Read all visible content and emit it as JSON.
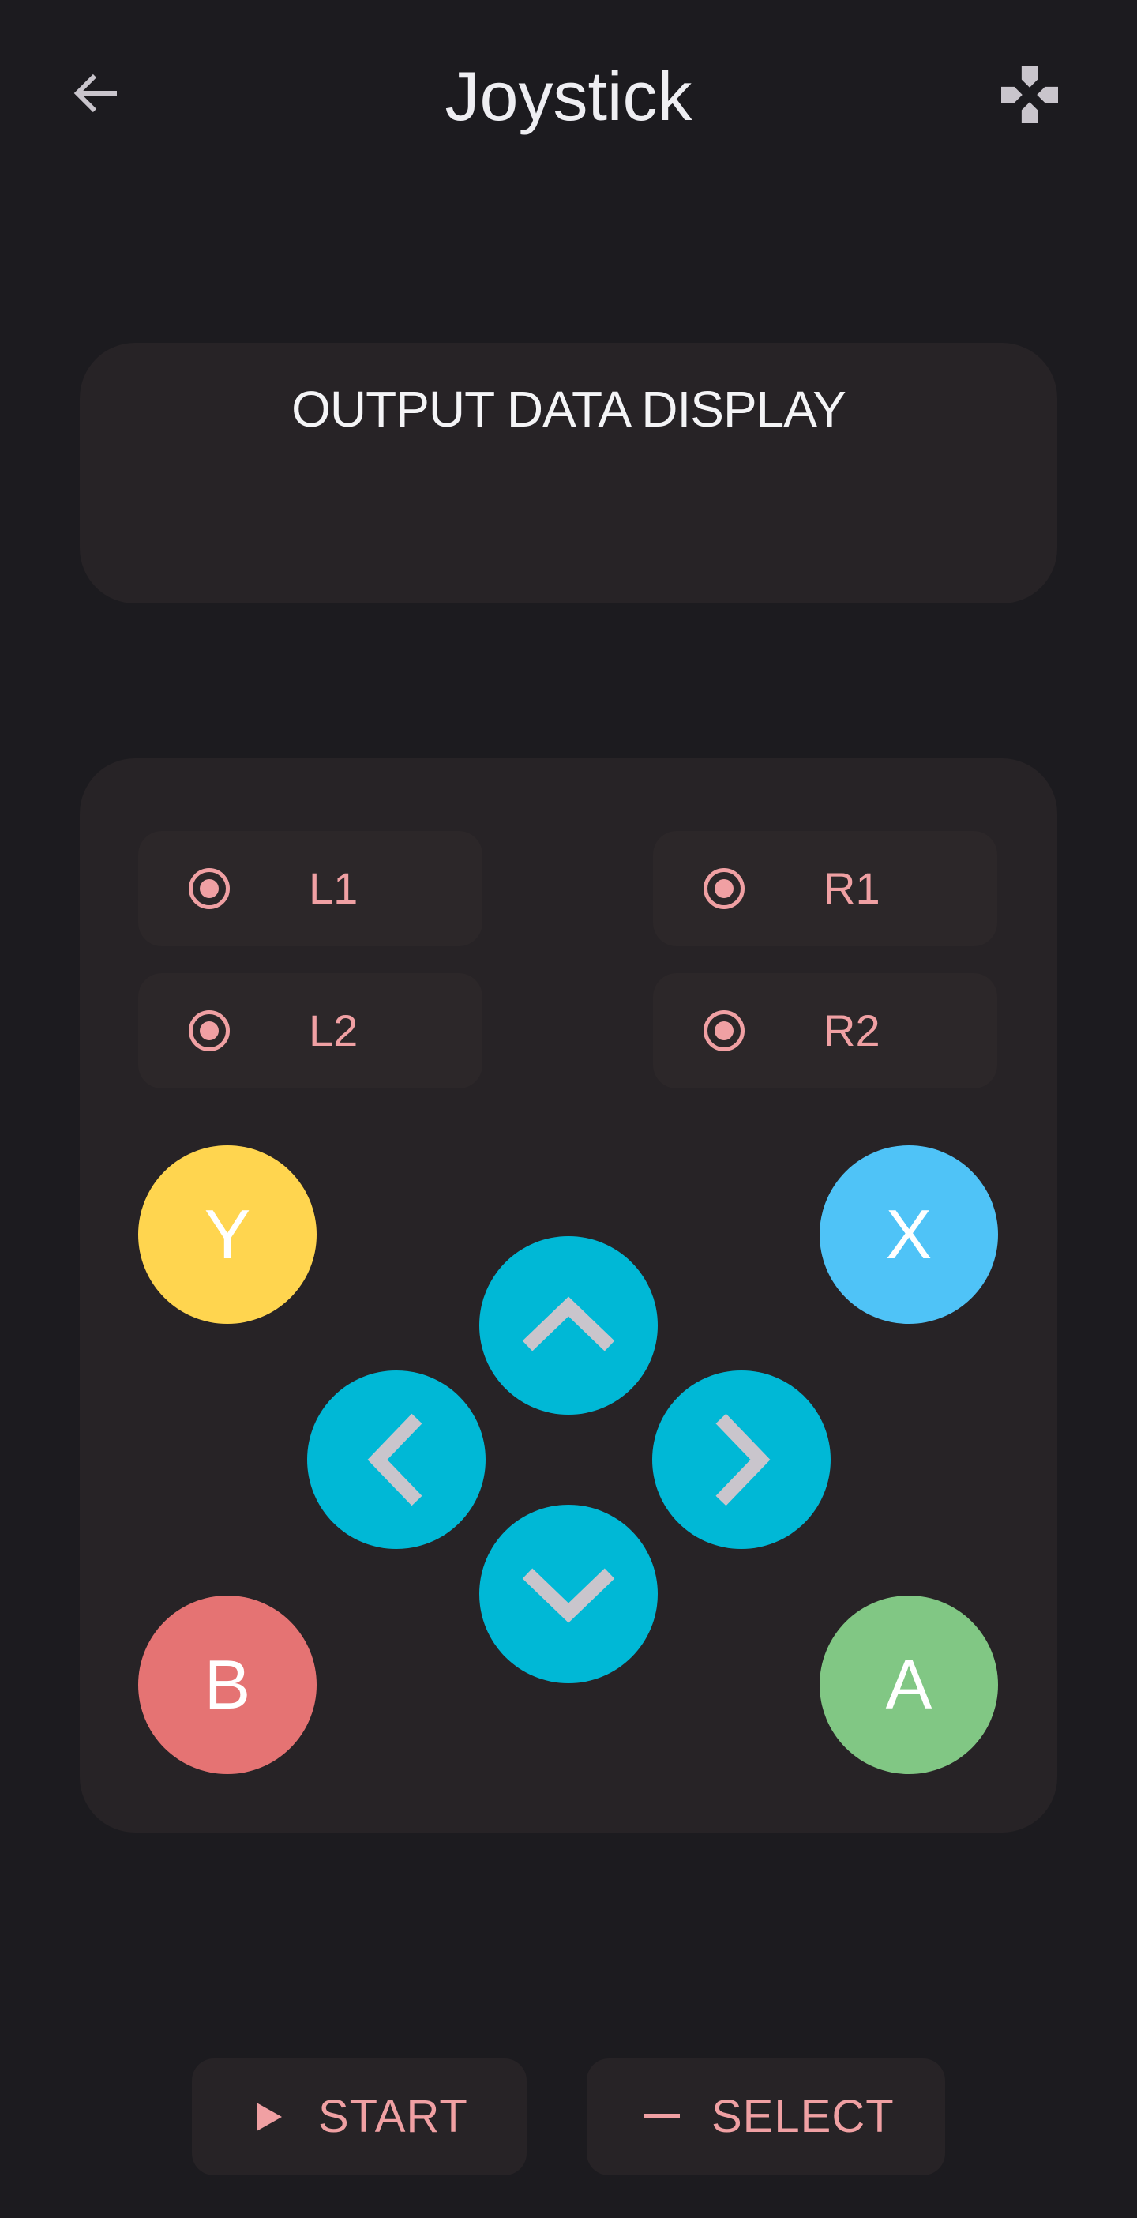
{
  "app_bar": {
    "title": "Joystick",
    "back_icon": "arrow-left-icon",
    "action_icon": "gamepad-icon"
  },
  "output": {
    "title": "OUTPUT DATA DISPLAY",
    "value": ""
  },
  "shoulders": {
    "l1": "L1",
    "r1": "R1",
    "l2": "L2",
    "r2": "R2"
  },
  "face_buttons": {
    "y": "Y",
    "x": "X",
    "b": "B",
    "a": "A"
  },
  "dpad": {
    "up_icon": "chevron-up-icon",
    "left_icon": "chevron-left-icon",
    "right_icon": "chevron-right-icon",
    "down_icon": "chevron-down-icon"
  },
  "bottom": {
    "start_label": "START",
    "select_label": "SELECT"
  },
  "colors": {
    "background": "#1c1b1f",
    "card": "#272326",
    "accent_pink": "#f0a0a3",
    "y": "#ffd54f",
    "x": "#4fc3f7",
    "b": "#e57373",
    "a": "#81c784",
    "dpad": "#00b8d6"
  }
}
